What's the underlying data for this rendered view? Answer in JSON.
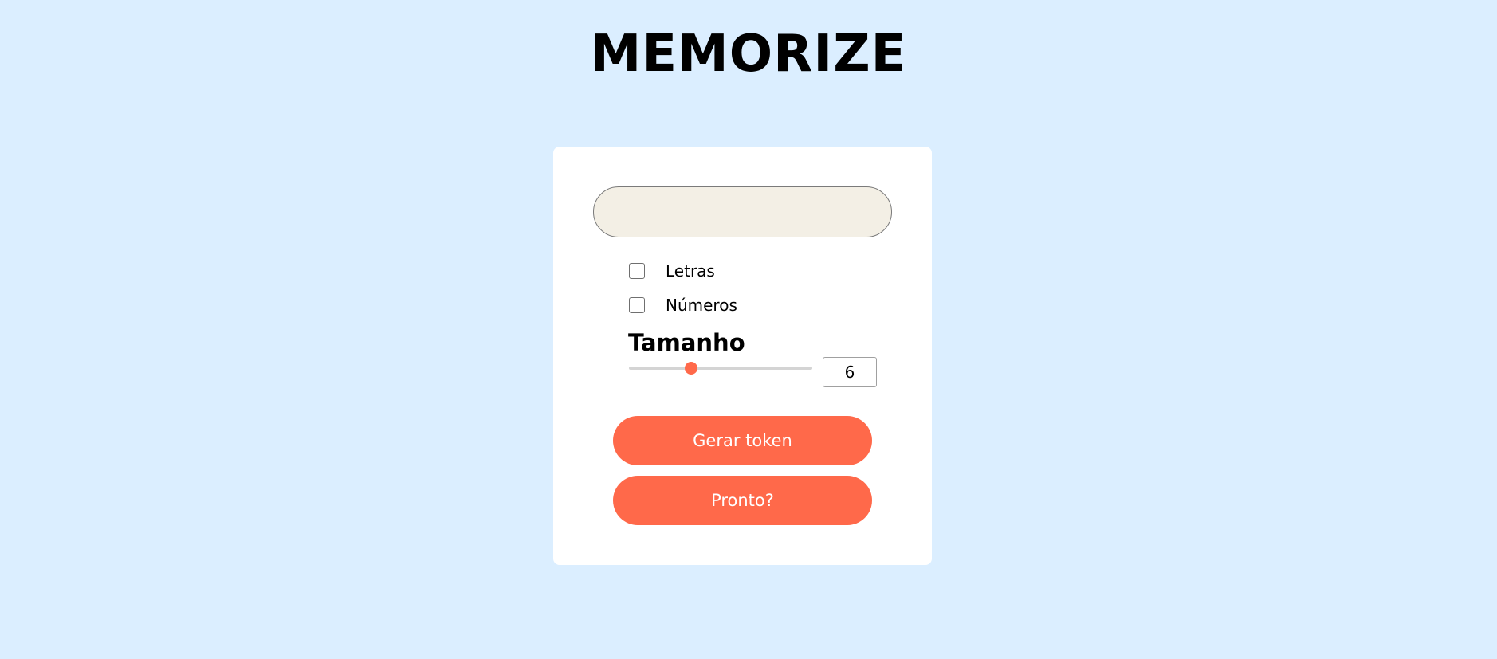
{
  "app": {
    "title": "MEMORIZE"
  },
  "token": {
    "value": ""
  },
  "options": {
    "letters": {
      "label": "Letras",
      "checked": false
    },
    "numbers": {
      "label": "Números",
      "checked": false
    }
  },
  "size": {
    "heading": "Tamanho",
    "value": "6",
    "slider_fraction": 0.34
  },
  "buttons": {
    "generate_label": "Gerar token",
    "ready_label": "Pronto?"
  },
  "colors": {
    "background": "#dbeeff",
    "card": "#ffffff",
    "accent": "#ff694a",
    "token_field": "#f3efe5"
  }
}
